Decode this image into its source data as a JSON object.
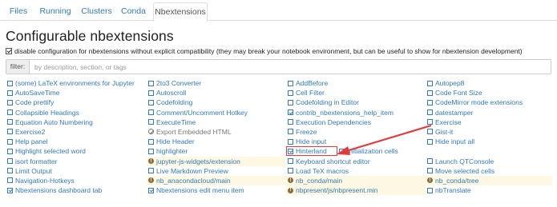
{
  "tabs": [
    {
      "label": "Files",
      "active": false
    },
    {
      "label": "Running",
      "active": false
    },
    {
      "label": "Clusters",
      "active": false
    },
    {
      "label": "Conda",
      "active": false
    },
    {
      "label": "Nbextensions",
      "active": true
    }
  ],
  "page_title": "Configurable nbextensions",
  "compat_label": "disable configuration for nbextensions without explicit compatibility (they may break your notebook environment, but can be useful to show for nbextension development)",
  "compat_checked": true,
  "filter": {
    "label": "filter:",
    "placeholder": "by description, section, or tags",
    "value": ""
  },
  "rows": [
    [
      {
        "label": "(some) LaTeX environments for Jupyter",
        "state": "unchecked"
      },
      {
        "label": "2to3 Converter",
        "state": "unchecked"
      },
      {
        "label": "AddBefore",
        "state": "unchecked"
      },
      {
        "label": "Autopep8",
        "state": "unchecked"
      }
    ],
    [
      {
        "label": "AutoSaveTime",
        "state": "unchecked"
      },
      {
        "label": "Autoscroll",
        "state": "unchecked"
      },
      {
        "label": "Cell Filter",
        "state": "unchecked"
      },
      {
        "label": "Code Font Size",
        "state": "unchecked"
      }
    ],
    [
      {
        "label": "Code prettify",
        "state": "unchecked"
      },
      {
        "label": "Codefolding",
        "state": "unchecked"
      },
      {
        "label": "Codefolding in Editor",
        "state": "unchecked"
      },
      {
        "label": "CodeMirror mode extensions",
        "state": "unchecked"
      }
    ],
    [
      {
        "label": "Collapsible Headings",
        "state": "unchecked"
      },
      {
        "label": "Comment/Uncomment Hotkey",
        "state": "unchecked"
      },
      {
        "label": "contrib_nbextensions_help_item",
        "state": "checked"
      },
      {
        "label": "datestamper",
        "state": "unchecked"
      }
    ],
    [
      {
        "label": "Equation Auto Numbering",
        "state": "unchecked"
      },
      {
        "label": "ExecuteTime",
        "state": "unchecked"
      },
      {
        "label": "Execution Dependencies",
        "state": "unchecked"
      },
      {
        "label": "Exercise",
        "state": "unchecked"
      }
    ],
    [
      {
        "label": "Exercise2",
        "state": "unchecked"
      },
      {
        "label": "Export Embedded HTML",
        "state": "disabled"
      },
      {
        "label": "Freeze",
        "state": "unchecked"
      },
      {
        "label": "Gist-it",
        "state": "unchecked"
      }
    ],
    [
      {
        "label": "Help panel",
        "state": "unchecked"
      },
      {
        "label": "Hide Header",
        "state": "unchecked"
      },
      {
        "label": "Hide input",
        "state": "unchecked"
      },
      {
        "label": "Hide input all",
        "state": "unchecked"
      }
    ],
    [
      {
        "label": "Highlight selected word",
        "state": "unchecked"
      },
      {
        "label": "highlighter",
        "state": "unchecked"
      },
      {
        "label": "Hinterland",
        "state": "checked",
        "selected": true
      },
      {
        "label": "Initialization cells",
        "state": "unchecked"
      }
    ],
    [
      {
        "label": "isort formatter",
        "state": "unchecked"
      },
      {
        "label": "jupyter-js-widgets/extension",
        "state": "warning"
      },
      {
        "label": "Keyboard shortcut editor",
        "state": "unchecked"
      },
      {
        "label": "Launch QTConsole",
        "state": "unchecked"
      }
    ],
    [
      {
        "label": "Limit Output",
        "state": "unchecked"
      },
      {
        "label": "Live Markdown Preview",
        "state": "unchecked"
      },
      {
        "label": "Load TeX macros",
        "state": "unchecked"
      },
      {
        "label": "Move selected cells",
        "state": "unchecked"
      }
    ],
    [
      {
        "label": "Navigation-Hotkeys",
        "state": "unchecked"
      },
      {
        "label": "nb_anacondacloud/main",
        "state": "warning"
      },
      {
        "label": "nb_conda/main",
        "state": "warning"
      },
      {
        "label": "nb_conda/tree",
        "state": "warning"
      }
    ],
    [
      {
        "label": "Nbextensions dashboard tab",
        "state": "checked"
      },
      {
        "label": "Nbextensions edit menu item",
        "state": "checked"
      },
      {
        "label": "nbpresent/js/nbpresent.min",
        "state": "warning"
      },
      {
        "label": "nbTranslate",
        "state": "unchecked"
      }
    ]
  ],
  "colors": {
    "link": "#337ab7",
    "warning_bg": "#fcf8e3",
    "annotation": "#e23b3b"
  }
}
